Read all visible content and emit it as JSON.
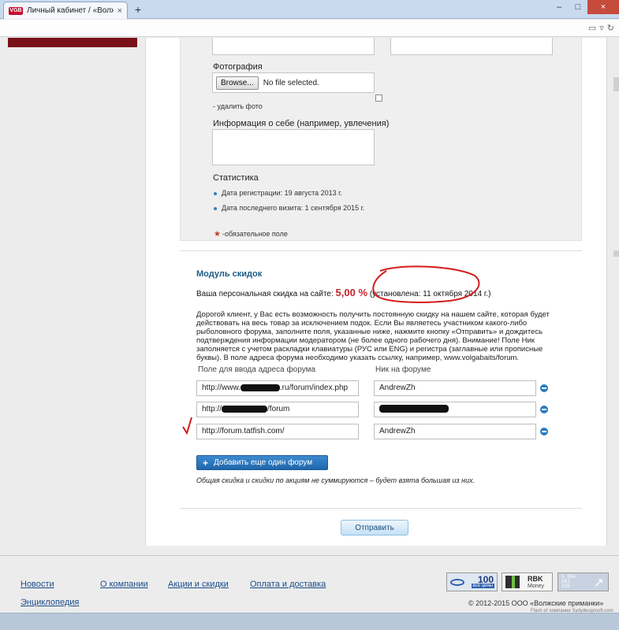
{
  "browser": {
    "tab_title": "Личный кабинет / «Волж...",
    "tab_favicon_text": "VGB",
    "tab_close": "×",
    "new_tab": "+",
    "minimize": "–",
    "maximize": "□",
    "close": "×"
  },
  "profile": {
    "photo_label": "Фотография",
    "browse_button": "Browse...",
    "file_status": "No file selected.",
    "delete_photo": "- удалить фото",
    "about_label": "Информация о себе (например, увлечения)",
    "stats_title": "Статистика",
    "registration_date": "Дата регистрации: 19 августа 2013 г.",
    "last_visit": "Дата последнего визита: 1 сентября 2015 г.",
    "required_note": "-обязательное поле"
  },
  "discounts": {
    "title": "Модуль скидок",
    "personal_prefix": "Ваша персональная скидка на сайте:",
    "personal_value": "5,00 %",
    "personal_suffix": "(установлена: 11 октября 2014 г.)",
    "description": "Дорогой клиент, у Вас есть возможность получить постоянную скидку на нашем сайте, которая будет действовать на весь товар за исключением подок. Если Вы являетесь участником какого-либо рыболовного форума, заполните поля, указанные ниже, нажмите кнопку «Отправить» и дождитесь подтверждения информации модератором (не более одного рабочего дня). Внимание! Поле Ник заполняется с учетом раскладки клавиатуры (РУС или ENG) и регистра (заглавные или прописные буквы). В поле адреса форума необходимо указать ссылку, например, www.volgabaits/forum.",
    "forum_url_header": "Поле для ввода адреса форума",
    "nick_header": "Ник на форуме",
    "forums": [
      {
        "url_start": "http://www.",
        "url_end": ".ru/forum/index.php",
        "nick": "AndrewZh"
      },
      {
        "url_start": "http://",
        "url_end": "/forum",
        "nick": ""
      },
      {
        "url_start": "http://forum.tatfish.com/",
        "url_end": "",
        "nick": "AndrewZh"
      }
    ],
    "add_forum_button": "Добавить еще один форум",
    "note": "Общая скидка и скидки по акциям не суммируются – будет взята большая из них.",
    "submit_button": "Отправить"
  },
  "footer": {
    "links": [
      "Новости",
      "О компании",
      "Акции и скидки",
      "Оплата и доставка",
      "Энциклопедия"
    ],
    "badge_100_number": "100",
    "badge_100_sub": "все цены",
    "badge_rbk_title": "RBK",
    "badge_rbk_sub": "Money",
    "badge_stat_digits": "5 684\n581\n335",
    "copyright": "© 2012-2015 ООО «Волжские приманки»",
    "credit": "Flash от компании Sydydesgnsoft.com"
  },
  "colors": {
    "accent_red": "#c0262c",
    "brand_dark_red": "#7a1119",
    "title_blue": "#1e5b86",
    "link_blue": "#1a4c8a",
    "button_blue": "#1f66ab",
    "annotation_red": "#d41b1b"
  }
}
